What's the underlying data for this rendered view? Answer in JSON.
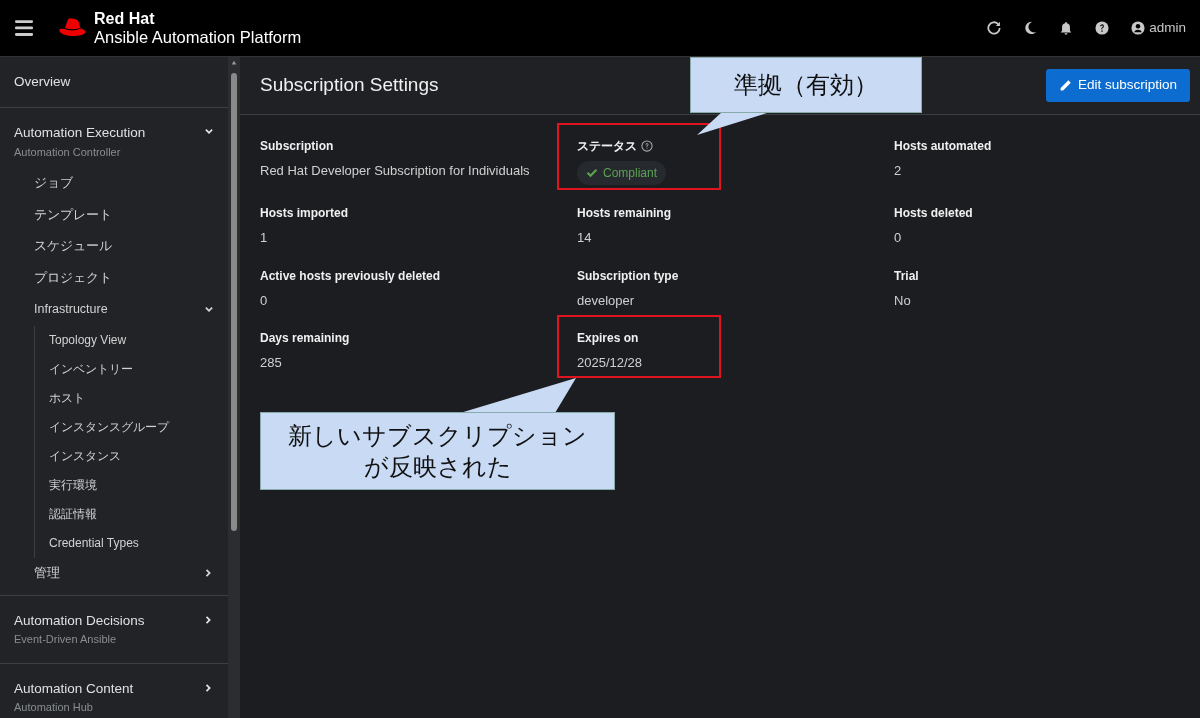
{
  "header": {
    "brand": "Red Hat",
    "product": "Ansible Automation Platform",
    "user": "admin"
  },
  "sidebar": {
    "items": [
      {
        "label": "Overview"
      },
      {
        "label": "Automation Execution",
        "subtitle": "Automation Controller",
        "expanded": true,
        "children": [
          {
            "label": "ジョブ"
          },
          {
            "label": "テンプレート"
          },
          {
            "label": "スケジュール"
          },
          {
            "label": "プロジェクト"
          },
          {
            "label": "Infrastructure",
            "expanded": true,
            "children": [
              {
                "label": "Topology View"
              },
              {
                "label": "インベントリー"
              },
              {
                "label": "ホスト"
              },
              {
                "label": "インスタンスグループ"
              },
              {
                "label": "インスタンス"
              },
              {
                "label": "実行環境"
              },
              {
                "label": "認証情報"
              },
              {
                "label": "Credential Types"
              }
            ]
          },
          {
            "label": "管理",
            "expanded": false
          }
        ]
      },
      {
        "label": "Automation Decisions",
        "subtitle": "Event-Driven Ansible",
        "expanded": false
      },
      {
        "label": "Automation Content",
        "subtitle": "Automation Hub",
        "expanded": false
      }
    ]
  },
  "page": {
    "title": "Subscription Settings",
    "edit_button": "Edit subscription"
  },
  "fields": [
    {
      "kind": "text",
      "label": "Subscription",
      "value": "Red Hat Developer Subscription for Individuals",
      "highlighted": false
    },
    {
      "kind": "status",
      "label": "ステータス",
      "value": "Compliant",
      "highlighted": true
    },
    {
      "kind": "text",
      "label": "Hosts automated",
      "value": "2",
      "highlighted": false
    },
    {
      "kind": "text",
      "label": "Hosts imported",
      "value": "1",
      "highlighted": false
    },
    {
      "kind": "text",
      "label": "Hosts remaining",
      "value": "14",
      "highlighted": false
    },
    {
      "kind": "text",
      "label": "Hosts deleted",
      "value": "0",
      "highlighted": false
    },
    {
      "kind": "text",
      "label": "Active hosts previously deleted",
      "value": "0",
      "highlighted": false
    },
    {
      "kind": "text",
      "label": "Subscription type",
      "value": "developer",
      "highlighted": false
    },
    {
      "kind": "text",
      "label": "Trial",
      "value": "No",
      "highlighted": false
    },
    {
      "kind": "text",
      "label": "Days remaining",
      "value": "285",
      "highlighted": false
    },
    {
      "kind": "text",
      "label": "Expires on",
      "value": "2025/12/28",
      "highlighted": true
    }
  ],
  "callouts": [
    {
      "text": "準拠（有効）"
    },
    {
      "text": "新しいサブスクリプションが反映された"
    }
  ]
}
